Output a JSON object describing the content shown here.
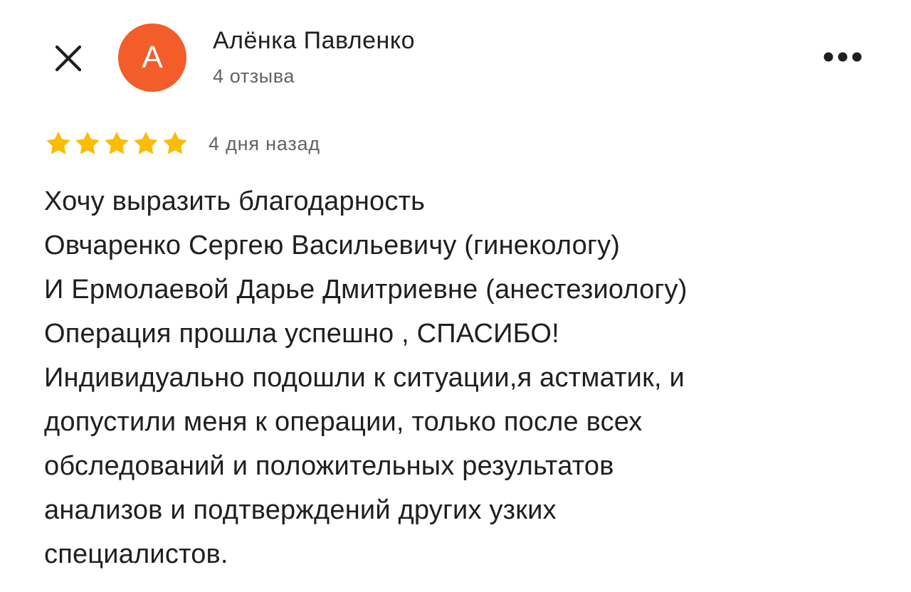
{
  "header": {
    "close_icon": "close-icon",
    "avatar_letter": "А",
    "avatar_color": "#f25d2a",
    "author_name": "Алёнка Павленко",
    "review_count": "4 отзыва",
    "more_icon": "more-horizontal-icon"
  },
  "review": {
    "rating": 5,
    "rating_max": 5,
    "star_color": "#fbbc04",
    "date": "4 дня назад",
    "lines": [
      "Хочу выразить благодарность",
      "Овчаренко Сергею Васильевичу (гинекологу)",
      "И Ермолаевой Дарье Дмитриевне (анестезиологу)",
      "Операция прошла успешно , СПАСИБО!",
      "Индивидуально подошли к ситуации,я астматик, и",
      "допустили меня к операции, только после всех",
      "обследований и положительных результатов",
      "анализов и подтверждений других узких",
      "специалистов."
    ]
  }
}
